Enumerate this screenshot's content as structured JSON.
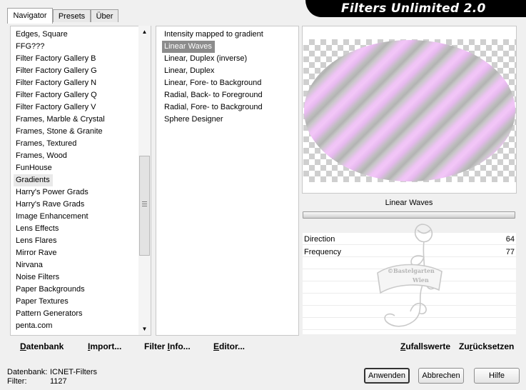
{
  "tabs": [
    {
      "label": "Navigator",
      "active": true
    },
    {
      "label": "Presets",
      "active": false
    },
    {
      "label": "Über",
      "active": false
    }
  ],
  "banner": {
    "title": "Filters Unlimited 2.0"
  },
  "categories": {
    "items": [
      "Edges, Square",
      "FFG???",
      "Filter Factory Gallery B",
      "Filter Factory Gallery G",
      "Filter Factory Gallery N",
      "Filter Factory Gallery Q",
      "Filter Factory Gallery V",
      "Frames, Marble & Crystal",
      "Frames, Stone & Granite",
      "Frames, Textured",
      "Frames, Wood",
      "FunHouse",
      "Gradients",
      "Harry's Power Grads",
      "Harry's Rave Grads",
      "Image Enhancement",
      "Lens Effects",
      "Lens Flares",
      "Mirror Rave",
      "Nirvana",
      "Noise Filters",
      "Paper Backgrounds",
      "Paper Textures",
      "Pattern Generators",
      "penta.com"
    ],
    "selected": "Gradients"
  },
  "filters": {
    "items": [
      "Intensity mapped to gradient",
      "Linear Waves",
      "Linear, Duplex (inverse)",
      "Linear, Duplex",
      "Linear, Fore- to Background",
      "Radial, Back- to Foreground",
      "Radial, Fore- to Background",
      "Sphere Designer"
    ],
    "selected": "Linear Waves"
  },
  "params": {
    "title": "Linear Waves",
    "rows": [
      {
        "label": "Direction",
        "value": "64"
      },
      {
        "label": "Frequency",
        "value": "77"
      }
    ]
  },
  "watermark": {
    "line1": "©Bastelgarten",
    "line2": "Wien"
  },
  "actions": {
    "database": {
      "pre": "",
      "u": "D",
      "post": "atenbank"
    },
    "import": {
      "pre": "",
      "u": "I",
      "post": "mport..."
    },
    "filter_info": {
      "pre": "Filter ",
      "u": "I",
      "post": "nfo..."
    },
    "editor": {
      "pre": "",
      "u": "E",
      "post": "ditor..."
    },
    "random": {
      "pre": "",
      "u": "Z",
      "post": "ufallswerte"
    },
    "reset": {
      "pre": "Zu",
      "u": "r",
      "post": "ücksetzen"
    }
  },
  "status": {
    "db_label": "Datenbank:",
    "db_value": "ICNET-Filters",
    "filter_label": "Filter:",
    "filter_value": "1127"
  },
  "buttons": {
    "apply": "Anwenden",
    "cancel": "Abbrechen",
    "help": "Hilfe"
  }
}
